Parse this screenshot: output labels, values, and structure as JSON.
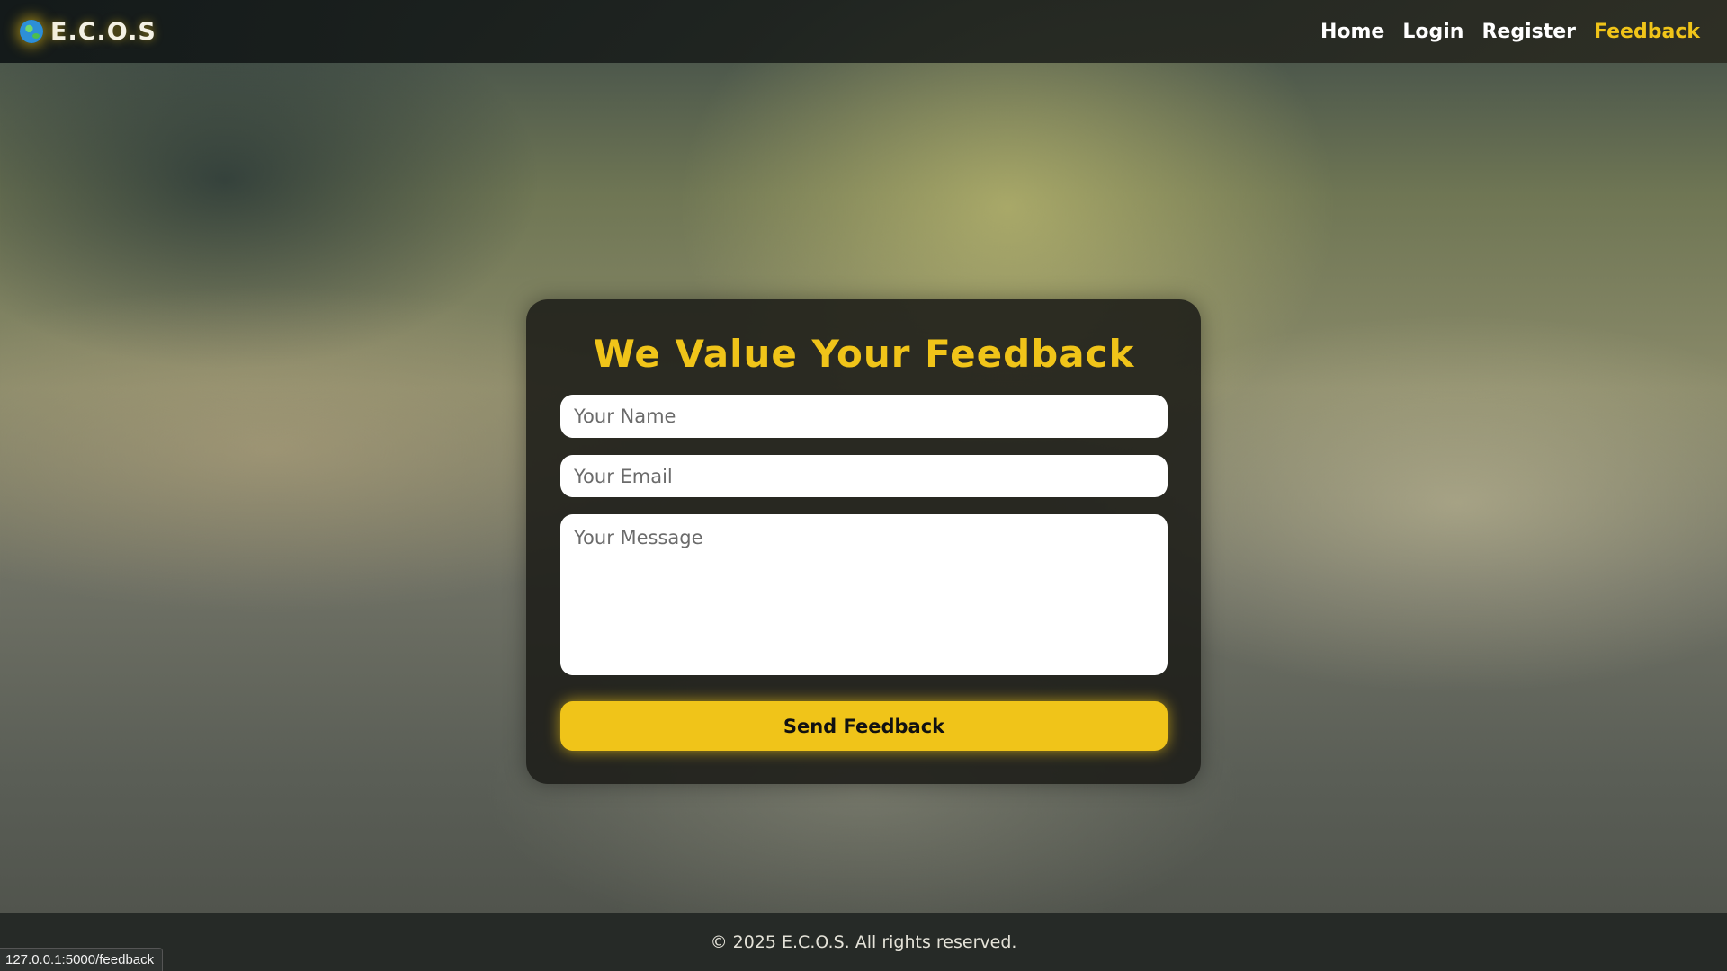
{
  "navbar": {
    "brand": "E.C.O.S",
    "brand_icon": "globe-icon",
    "links": [
      {
        "label": "Home"
      },
      {
        "label": "Login"
      },
      {
        "label": "Register"
      },
      {
        "label": "Feedback",
        "active": true
      }
    ]
  },
  "feedback_form": {
    "title": "We Value Your Feedback",
    "name_placeholder": "Your Name",
    "email_placeholder": "Your Email",
    "message_placeholder": "Your Message",
    "submit_label": "Send Feedback"
  },
  "footer": {
    "text": "© 2025 E.C.O.S. All rights reserved."
  },
  "status_bar": {
    "url": "127.0.0.1:5000/feedback"
  },
  "colors": {
    "accent": "#f0c419",
    "nav_background": "#1c2220",
    "card_background": "#1c1c18",
    "footer_background": "#262a27"
  }
}
